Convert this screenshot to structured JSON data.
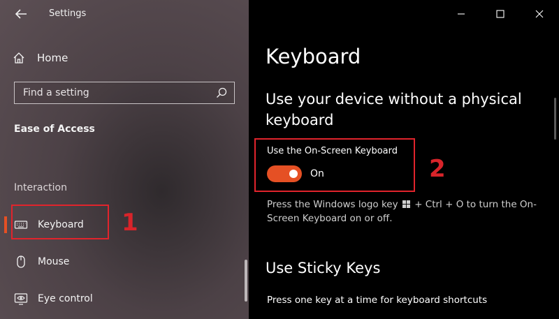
{
  "window": {
    "title": "Settings"
  },
  "sidebar": {
    "home_label": "Home",
    "search_placeholder": "Find a setting",
    "section_title": "Ease of Access",
    "group_label": "Interaction",
    "items": [
      {
        "label": "Keyboard",
        "icon": "keyboard-icon",
        "active": true
      },
      {
        "label": "Mouse",
        "icon": "mouse-icon",
        "active": false
      },
      {
        "label": "Eye control",
        "icon": "eye-control-icon",
        "active": false
      }
    ]
  },
  "annotations": {
    "marker_1": "1",
    "marker_2": "2",
    "highlight_color": "#e1242c"
  },
  "content": {
    "page_title": "Keyboard",
    "section_heading": "Use your device without a physical keyboard",
    "osk": {
      "label": "Use the On-Screen Keyboard",
      "state": "On",
      "enabled": true,
      "help_before": "Press the Windows logo key",
      "help_after": "+ Ctrl + O to turn the On-Screen Keyboard on or off."
    },
    "sticky": {
      "title": "Use Sticky Keys",
      "description": "Press one key at a time for keyboard shortcuts"
    }
  },
  "colors": {
    "accent": "#e55024",
    "content_bg": "#000000",
    "sidebar_bg": "#4c4146"
  }
}
